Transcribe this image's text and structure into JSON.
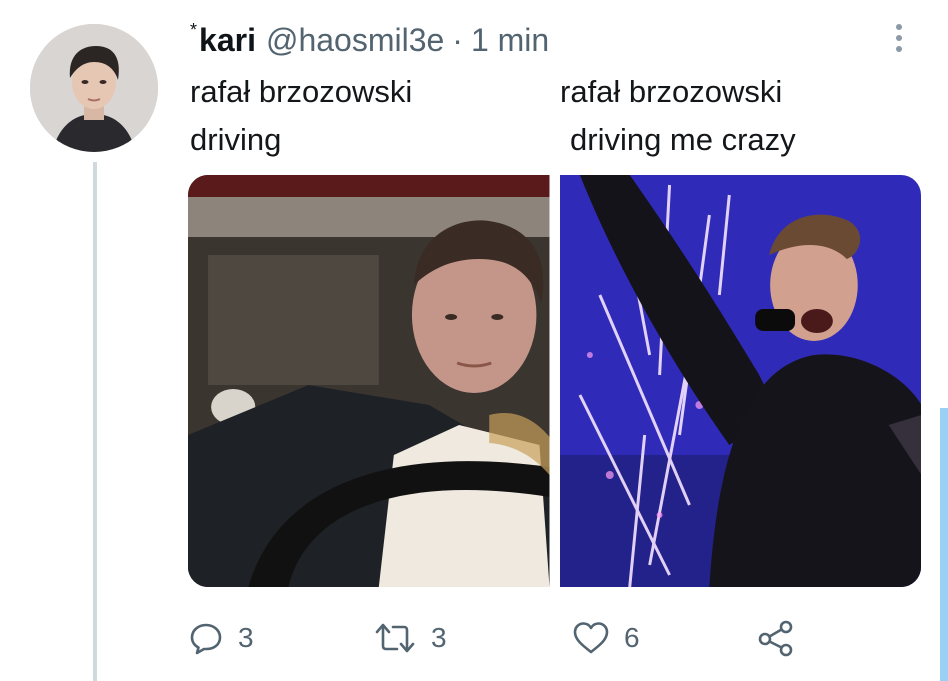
{
  "tweet": {
    "name_mark": "*",
    "display_name": "kari",
    "handle": "@haosmil3e",
    "separator": "·",
    "time": "1 min",
    "caption_left": [
      "rafał brzozowski",
      "driving"
    ],
    "caption_right": [
      "rafał brzozowski",
      "driving me crazy"
    ]
  },
  "icons": {
    "avatar": "profile-photo",
    "more": "vertical-ellipsis-icon",
    "reply": "speech-bubble-icon",
    "retweet": "retweet-arrows-icon",
    "like": "heart-icon",
    "share": "share-nodes-icon"
  },
  "actions": {
    "reply_count": "3",
    "retweet_count": "3",
    "like_count": "6"
  },
  "colors": {
    "text": "#0f1419",
    "muted": "#536471",
    "thread_line": "#cfd9de",
    "scroll_indicator": "#9ad0f5"
  }
}
